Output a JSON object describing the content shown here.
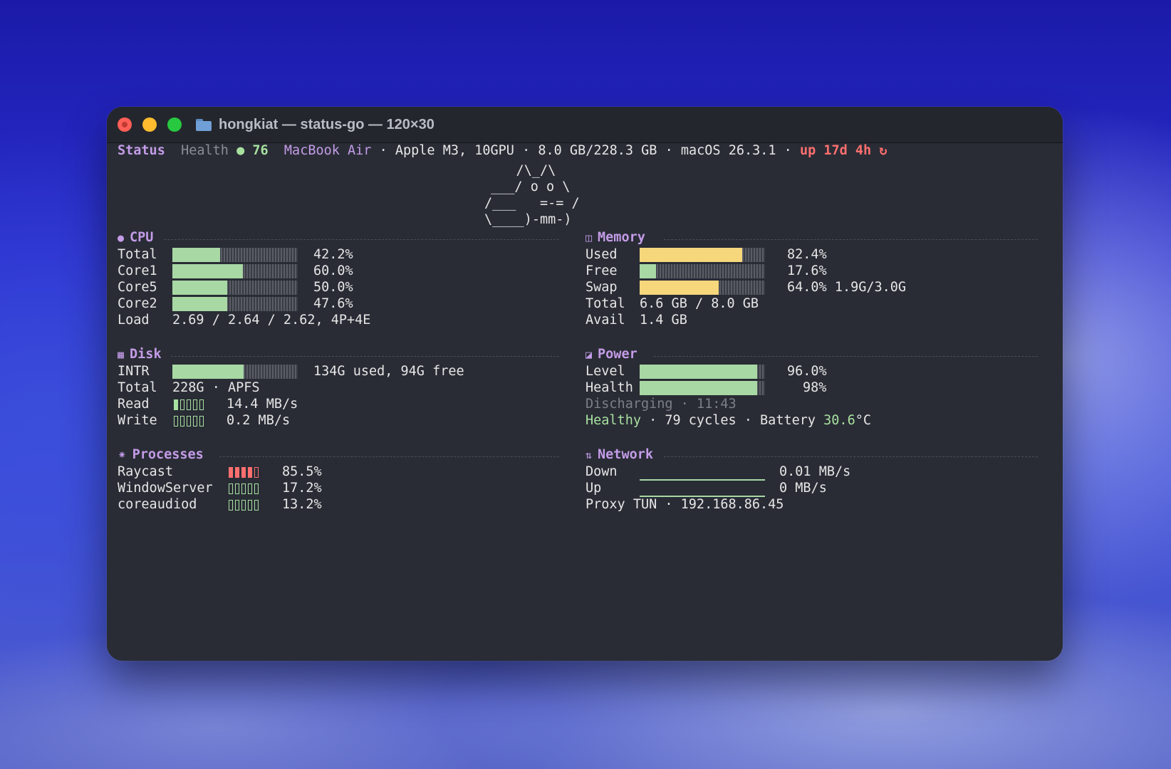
{
  "window": {
    "title": "hongkiat — status-go — 120×30"
  },
  "header": {
    "status": "Status",
    "health_label": "Health",
    "health_dot": "●",
    "health_value": "76",
    "model": "MacBook Air",
    "sep": "·",
    "chip": "Apple M3, 10GPU",
    "storage": "8.0 GB/228.3 GB",
    "os": "macOS 26.3.1",
    "uptime": "up 17d 4h",
    "refresh_glyph": "↻"
  },
  "ascii_art": [
    "    /\\_/\\",
    "___/ o o \\",
    "/___   =-= /",
    "\\____)-mm-)"
  ],
  "cpu": {
    "title": "CPU",
    "icon": "●",
    "rows": [
      {
        "label": "Total",
        "value": "42.2%",
        "fill": 0.38
      },
      {
        "label": "Core1",
        "value": "60.0%",
        "fill": 0.56
      },
      {
        "label": "Core5",
        "value": "50.0%",
        "fill": 0.44
      },
      {
        "label": "Core2",
        "value": "47.6%",
        "fill": 0.44
      }
    ],
    "load_label": "Load",
    "load_value": "2.69 / 2.64 / 2.62, 4P+4E"
  },
  "memory": {
    "title": "Memory",
    "icon": "◫",
    "rows": [
      {
        "label": "Used",
        "value": "82.4%",
        "fill": 0.82,
        "color": "#f6d77c"
      },
      {
        "label": "Free",
        "value": "17.6%",
        "fill": 0.13,
        "color": "#a8d8a4"
      },
      {
        "label": "Swap",
        "value": "64.0% 1.9G/3.0G",
        "fill": 0.63,
        "color": "#f6d77c"
      }
    ],
    "total_label": "Total",
    "total_value": "6.6 GB / 8.0 GB",
    "avail_label": "Avail",
    "avail_value": "1.4 GB"
  },
  "disk": {
    "title": "Disk",
    "icon": "▦",
    "intr_label": "INTR",
    "intr_value": "134G used, 94G free",
    "intr_fill": 0.57,
    "total_label": "Total",
    "total_value": "228G · APFS",
    "read_label": "Read",
    "read_value": "14.4 MB/s",
    "read_level": 1,
    "write_label": "Write",
    "write_value": "0.2 MB/s",
    "write_level": 0
  },
  "power": {
    "title": "Power",
    "icon": "◪",
    "level_label": "Level",
    "level_value": "96.0%",
    "level_fill": 0.94,
    "health_label": "Health",
    "health_value": "98%",
    "health_fill": 0.94,
    "status": "Discharging · 11:43",
    "condition": "Healthy",
    "cycles": "· 79 cycles · Battery",
    "temp_num": "30.6",
    "temp_unit": "°C"
  },
  "processes": {
    "title": "Processes",
    "icon": "⁕",
    "rows": [
      {
        "name": "Raycast",
        "value": "85.5%",
        "level": 4,
        "color": "red"
      },
      {
        "name": "WindowServer",
        "value": "17.2%",
        "level": 0,
        "color": "green"
      },
      {
        "name": "coreaudiod",
        "value": "13.2%",
        "level": 0,
        "color": "green"
      }
    ]
  },
  "network": {
    "title": "Network",
    "icon": "⇅",
    "down_label": "Down",
    "down_value": "0.01 MB/s",
    "up_label": "Up",
    "up_value": "0 MB/s",
    "proxy": "Proxy TUN · 192.168.86.45"
  },
  "colors": {
    "accent": "#c49ce8",
    "good": "#a8e0a0",
    "warn": "#f6d77c",
    "bad": "#ff6f6f",
    "bg": "#292c35"
  }
}
